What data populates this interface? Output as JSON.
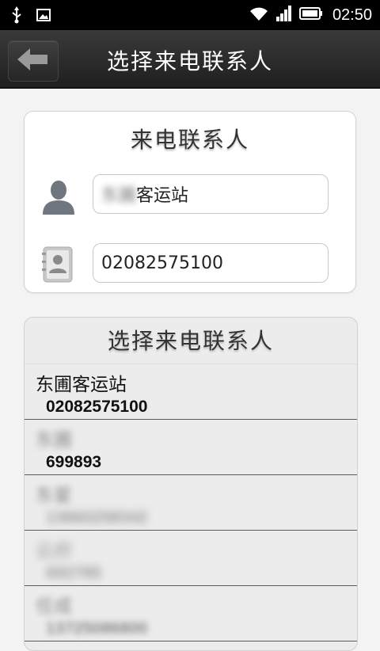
{
  "status_bar": {
    "time": "02:50",
    "icons": [
      "usb-icon",
      "image-icon",
      "wifi-icon",
      "signal-icon",
      "battery-icon"
    ]
  },
  "header": {
    "title": "选择来电联系人",
    "back_icon": "back-arrow-icon"
  },
  "form": {
    "title": "来电联系人",
    "name_value_blurred": "东圃",
    "name_value_clear": "客运站",
    "phone_value": "02082575100",
    "name_icon": "person-icon",
    "phone_icon": "contact-book-icon"
  },
  "contacts": {
    "title": "选择来电联系人",
    "items": [
      {
        "name": "东圃客运站",
        "phone": "02082575100"
      },
      {
        "name": "东圃",
        "phone": "699893"
      },
      {
        "name": "东星",
        "phone": "13660258342"
      },
      {
        "name": "云府",
        "phone": "692785"
      },
      {
        "name": "任成",
        "phone": "13725086800"
      }
    ]
  },
  "colors": {
    "header_bg": "#2a2a2a",
    "page_bg": "#f3f3f3",
    "divider": "#5a5a5a"
  }
}
